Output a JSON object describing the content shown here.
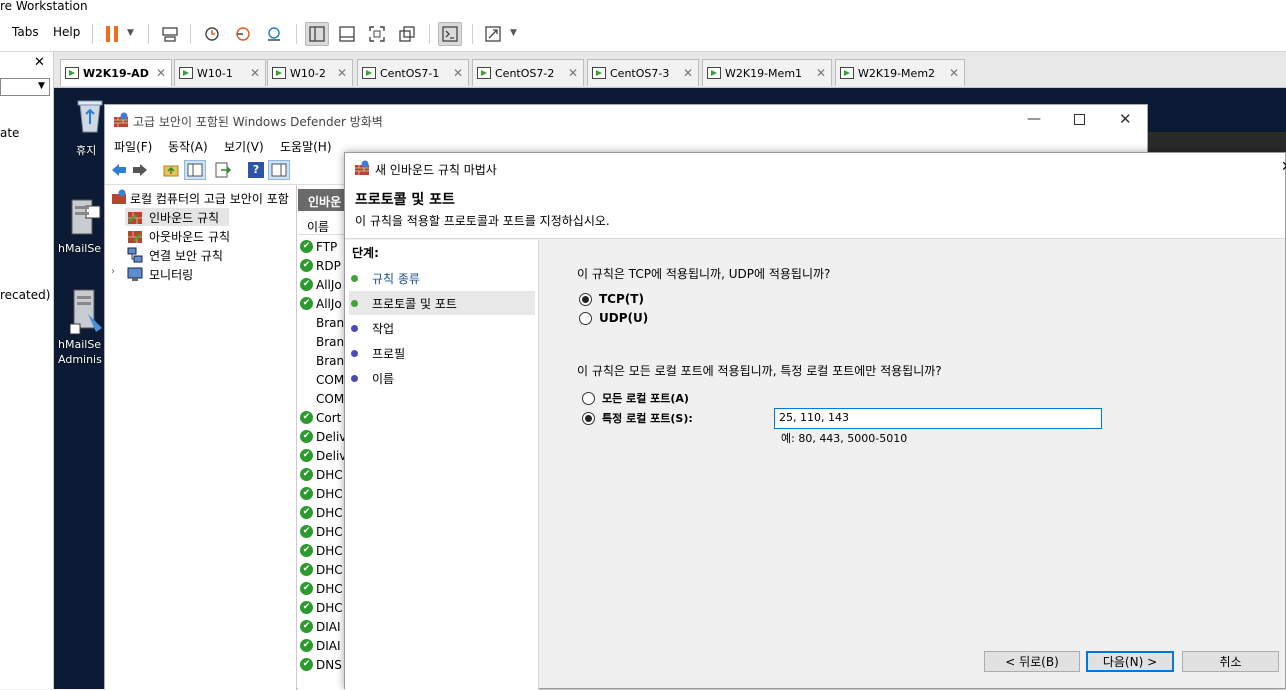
{
  "vmware": {
    "title": "re Workstation",
    "menu": {
      "tabs": "Tabs",
      "help": "Help"
    },
    "sidebar_close": "✕",
    "sidebar_items": [
      "ate",
      "recated)"
    ],
    "tabs": [
      {
        "label": "W2K19-AD",
        "active": true
      },
      {
        "label": "W10-1"
      },
      {
        "label": "W10-2"
      },
      {
        "label": "CentOS7-1"
      },
      {
        "label": "CentOS7-2"
      },
      {
        "label": "CentOS7-3"
      },
      {
        "label": "W2K19-Mem1"
      },
      {
        "label": "W2K19-Mem2"
      }
    ],
    "tab_close": "✕"
  },
  "desktop": {
    "recycle_bin": "휴지",
    "hmail1": "hMailSe",
    "hmail2_line1": "hMailSe",
    "hmail2_line2": "Adminis"
  },
  "firewall": {
    "title": "고급 보안이 포함된 Windows Defender 방화벽",
    "menu": [
      "파일(F)",
      "동작(A)",
      "보기(V)",
      "도움말(H)"
    ],
    "tree_root": "로컬 컴퓨터의 고급 보안이 포함",
    "tree_items": [
      "인바운드 규칙",
      "아웃바운드 규칙",
      "연결 보안 규칙",
      "모니터링"
    ],
    "list_header": "인바운",
    "column_name": "이름",
    "rows": [
      {
        "text": "FTP",
        "check": true
      },
      {
        "text": "RDP",
        "check": true
      },
      {
        "text": "AllJo",
        "check": true
      },
      {
        "text": "AllJo",
        "check": true
      },
      {
        "text": "Bran",
        "check": false
      },
      {
        "text": "Bran",
        "check": false
      },
      {
        "text": "Bran",
        "check": false
      },
      {
        "text": "COM",
        "check": false
      },
      {
        "text": "COM",
        "check": false
      },
      {
        "text": "Cort",
        "check": true
      },
      {
        "text": "Deliv",
        "check": true
      },
      {
        "text": "Deliv",
        "check": true
      },
      {
        "text": "DHC",
        "check": true
      },
      {
        "text": "DHC",
        "check": true
      },
      {
        "text": "DHC",
        "check": true
      },
      {
        "text": "DHC",
        "check": true
      },
      {
        "text": "DHC",
        "check": true
      },
      {
        "text": "DHC",
        "check": true
      },
      {
        "text": "DHC",
        "check": true
      },
      {
        "text": "DHC",
        "check": true
      },
      {
        "text": "DIAI",
        "check": true
      },
      {
        "text": "DIAI",
        "check": true
      },
      {
        "text": "DNS",
        "check": true
      }
    ]
  },
  "wizard": {
    "title": "새 인바운드 규칙 마법사",
    "heading": "프로토콜 및 포트",
    "subheading": "이 규칙을 적용할 프로토콜과 포트를 지정하십시오.",
    "steps_label": "단계:",
    "steps": [
      {
        "label": "규칙 종류",
        "state": "done"
      },
      {
        "label": "프로토콜 및 포트",
        "state": "current"
      },
      {
        "label": "작업",
        "state": "pending"
      },
      {
        "label": "프로필",
        "state": "pending"
      },
      {
        "label": "이름",
        "state": "pending"
      }
    ],
    "q1": "이 규칙은 TCP에 적용됩니까, UDP에 적용됩니까?",
    "tcp": "TCP(T)",
    "udp": "UDP(U)",
    "protocol_selected": "TCP",
    "q2": "이 규칙은 모든 로컬 포트에 적용됩니까, 특정 로컬 포트에만 적용됩니까?",
    "all_ports": "모든 로컬 포트(A)",
    "specific_ports": "특정 로컬 포트(S):",
    "ports_selected": "specific",
    "ports_value": "25, 110, 143",
    "ports_example": "예: 80, 443, 5000-5010",
    "back": "< 뒤로(B)",
    "next": "다음(N) >",
    "cancel": "취소"
  },
  "colors": {
    "accent": "#0078d7",
    "done_bullet": "#3fa535",
    "pending_bullet": "#4a4ab8",
    "step_text_done": "#1a4d8f",
    "desktop_bg": "#0c1a35"
  }
}
